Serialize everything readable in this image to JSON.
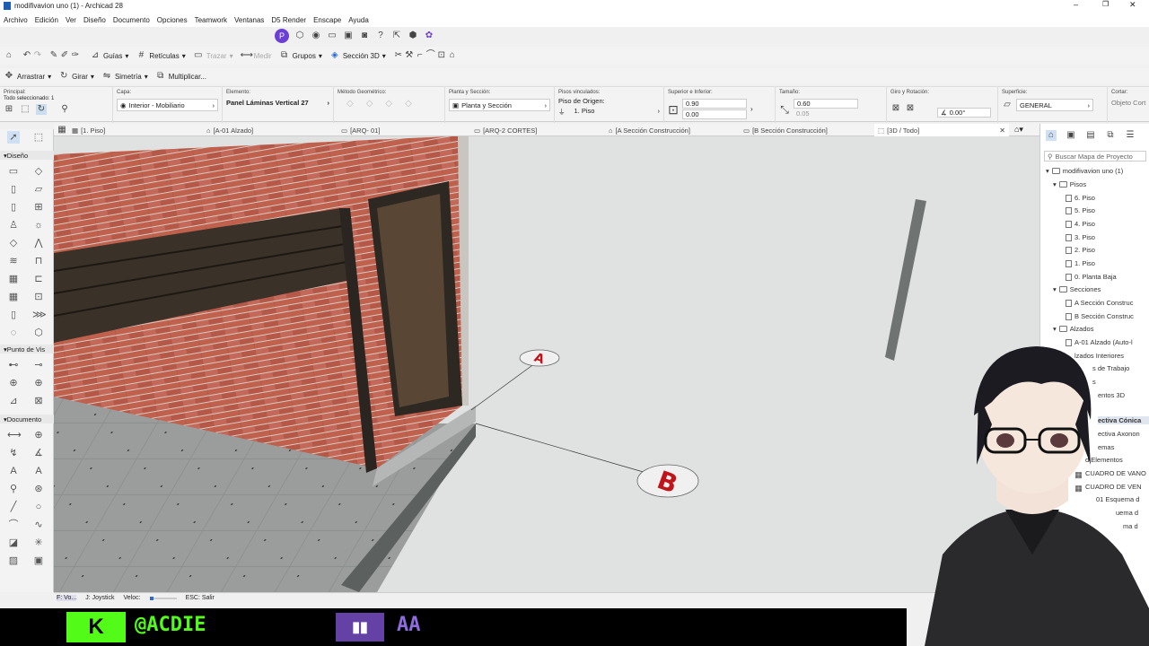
{
  "window": {
    "title": "modifivavion uno (1) - Archicad 28"
  },
  "menu": [
    "Archivo",
    "Edición",
    "Ver",
    "Diseño",
    "Documento",
    "Opciones",
    "Teamwork",
    "Ventanas",
    "D5 Render",
    "Enscape",
    "Ayuda"
  ],
  "toolbar1": {
    "guias": "Guías",
    "reticulas": "Retículas",
    "trazar": "Trazar",
    "medir": "Medir",
    "grupos": "Grupos",
    "seccion3d": "Sección 3D"
  },
  "toolbar2": {
    "arrastrar": "Arrastrar",
    "girar": "Girar",
    "simetria": "Simetría",
    "multiplicar": "Multiplicar..."
  },
  "infobox": {
    "principal": {
      "label": "Principal:",
      "value": "Todo seleccionado: 1"
    },
    "capa": {
      "label": "Capa:",
      "value": "Interior - Mobiliario"
    },
    "elemento": {
      "label": "Elemento:",
      "value": "Panel Láminas Vertical 27"
    },
    "metodo": {
      "label": "Método Geométrico:"
    },
    "planta": {
      "label": "Planta y Sección:",
      "value": "Planta y Sección"
    },
    "pisos": {
      "label": "Pisos vinculados:",
      "origen": "Piso de Origen:",
      "piso": "1. Piso"
    },
    "superior": {
      "label": "Superior e Inferior:",
      "v1": "0.90",
      "v2": "0.00"
    },
    "tamano": {
      "label": "Tamaño:",
      "v1": "0.60",
      "v2": "0.05"
    },
    "giro": {
      "label": "Giro y Rotación:",
      "angle": "0.00°"
    },
    "superficie": {
      "label": "Superficie:",
      "value": "GENERAL"
    },
    "cortar": {
      "label": "Cortar:",
      "value": "Objeto Cort"
    }
  },
  "tabs": [
    "[1. Piso]",
    "[A-01 Alzado]",
    "[ARQ- 01]",
    "[ARQ-2 CORTES]",
    "[A Sección Construcción]",
    "[B Sección Construcción]",
    "[3D / Todo]"
  ],
  "toolbox": {
    "diseno": "Diseño",
    "punto": "Punto de Vis",
    "documento": "Documento"
  },
  "navigator": {
    "search": "Buscar Mapa de Proyecto",
    "items": [
      "modifivavion uno (1)",
      "Pisos",
      "6. Piso",
      "5. Piso",
      "4. Piso",
      "3. Piso",
      "2. Piso",
      "1. Piso",
      "0. Planta Baja",
      "Secciones",
      "A Sección Construc",
      "B Sección Construc",
      "Alzados",
      "A-01 Alzado (Auto-l",
      "lzados Interiores",
      "s de Trabajo",
      "s",
      "entos 3D",
      "ectiva Cónica",
      "ectiva Axonon",
      "emas",
      "d Elementos",
      "CUADRO DE VANO",
      "CUADRO DE VEN",
      "01 Esquema d",
      "uema d",
      "ma d"
    ]
  },
  "status": {
    "fvo": "F: Vo...",
    "joystick": "J: Joystick",
    "veloc": "Veloc:",
    "esc": "ESC: Salir"
  },
  "markers": {
    "a": "A",
    "b": "B"
  },
  "stream": {
    "kick": "@ACDIE",
    "twitch": "AA"
  }
}
